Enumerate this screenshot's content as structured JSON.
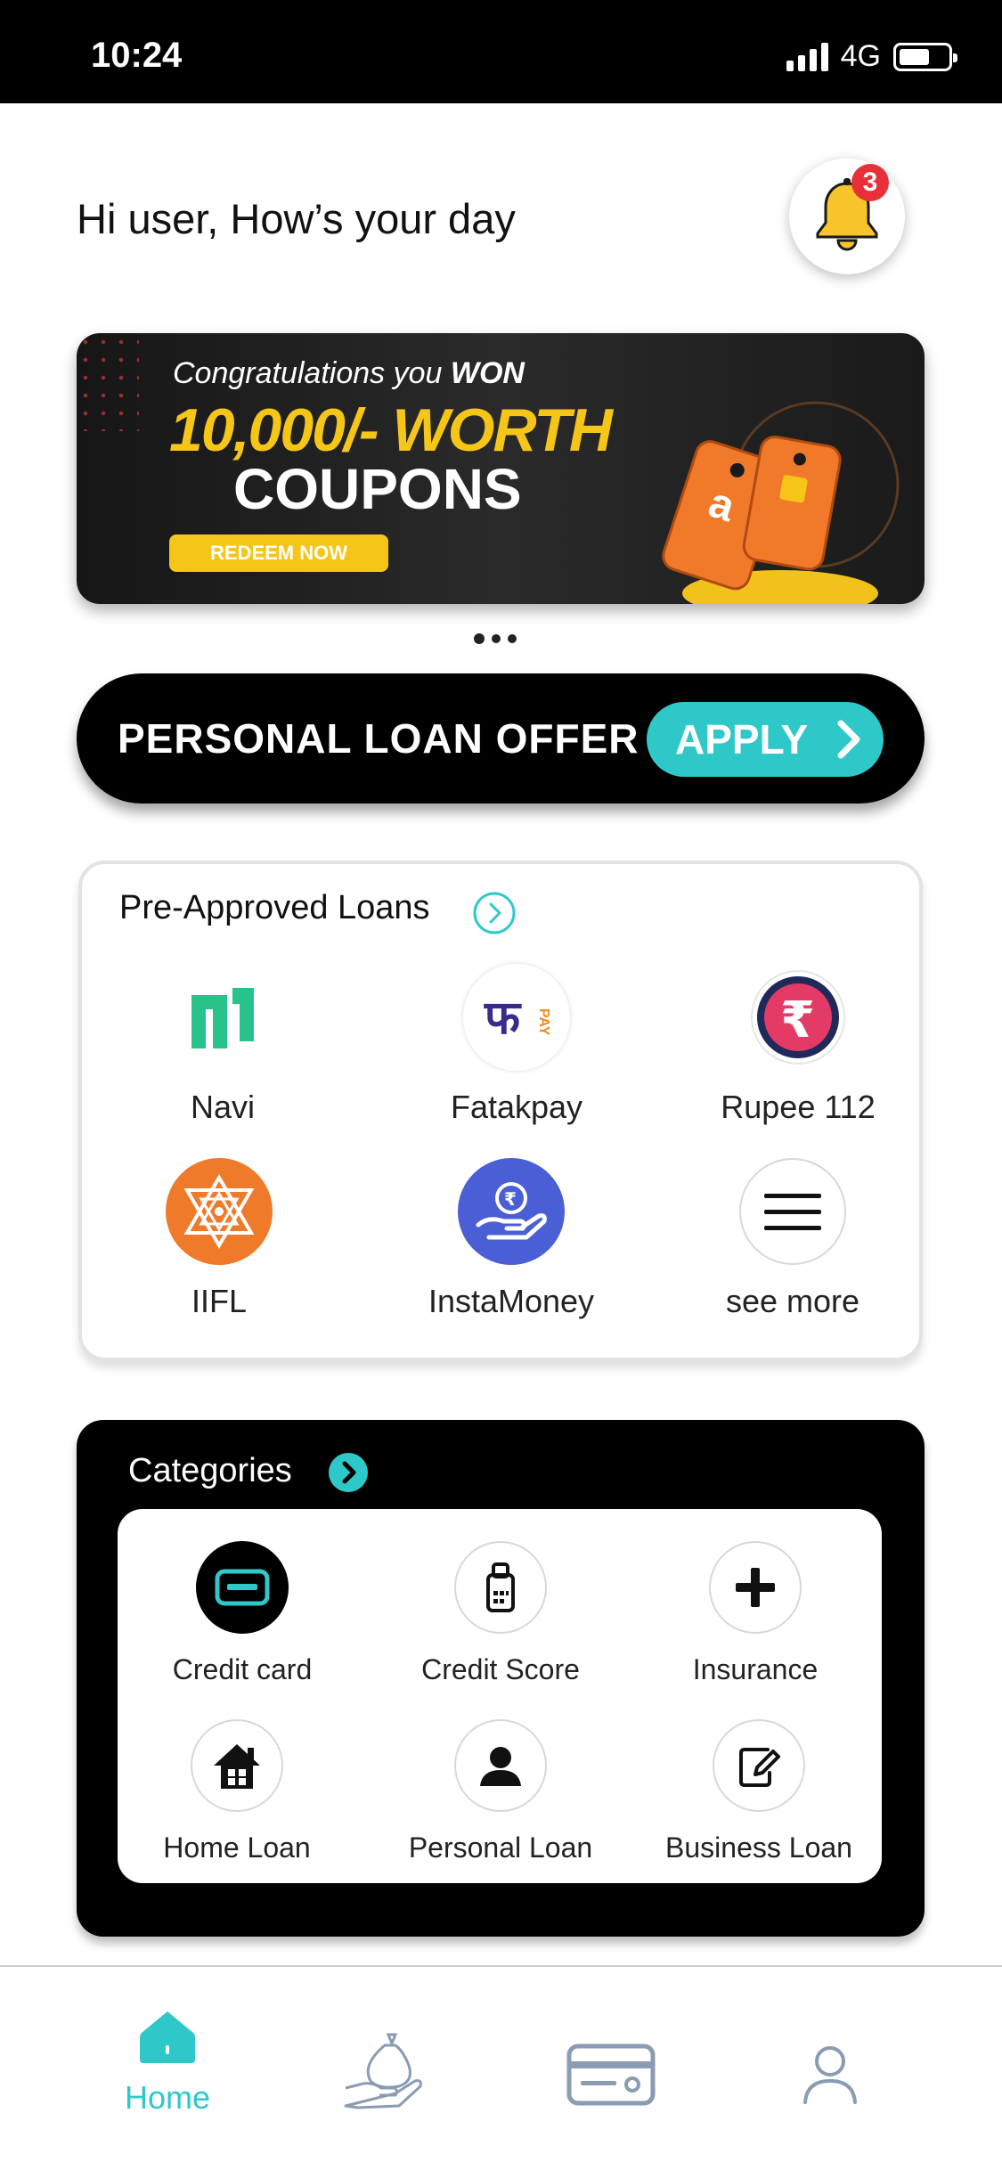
{
  "status_bar": {
    "time": "10:24",
    "network": "4G"
  },
  "header": {
    "greeting": "Hi user, How’s your day",
    "notification_count": "3"
  },
  "banner": {
    "line1_prefix": "Congratulations you",
    "line1_bold": "WON",
    "line2": "10,000/- WORTH",
    "line3": "COUPONS",
    "button": "REDEEM NOW",
    "page_count": 3,
    "active_page": 1
  },
  "loan_offer": {
    "label": "PERSONAL LOAN OFFER",
    "button": "APPLY"
  },
  "pre_approved": {
    "title": "Pre-Approved Loans",
    "lenders": [
      {
        "name": "Navi",
        "icon": "navi-logo"
      },
      {
        "name": "Fatakpay",
        "icon": "fatakpay-logo"
      },
      {
        "name": "Rupee 112",
        "icon": "rupee-logo"
      },
      {
        "name": "IIFL",
        "icon": "iifl-logo"
      },
      {
        "name": "InstaMoney",
        "icon": "instamoney-logo"
      },
      {
        "name": "see more",
        "icon": "menu-icon"
      }
    ]
  },
  "categories": {
    "title": "Categories",
    "items": [
      {
        "name": "Credit card",
        "icon": "credit-card-icon"
      },
      {
        "name": "Credit Score",
        "icon": "calculator-icon"
      },
      {
        "name": "Insurance",
        "icon": "plus-icon"
      },
      {
        "name": "Home Loan",
        "icon": "house-icon"
      },
      {
        "name": "Personal Loan",
        "icon": "person-icon"
      },
      {
        "name": "Business Loan",
        "icon": "edit-document-icon"
      }
    ]
  },
  "bottom_nav": {
    "items": [
      {
        "label": "Home",
        "icon": "home-icon",
        "active": true
      },
      {
        "label": "",
        "icon": "money-bag-hand-icon",
        "active": false
      },
      {
        "label": "",
        "icon": "card-icon",
        "active": false
      },
      {
        "label": "",
        "icon": "profile-icon",
        "active": false
      }
    ]
  },
  "colors": {
    "accent": "#2fc8c8",
    "dark": "#000000",
    "badge": "#e8303a",
    "banner_gold": "#f5c518"
  }
}
